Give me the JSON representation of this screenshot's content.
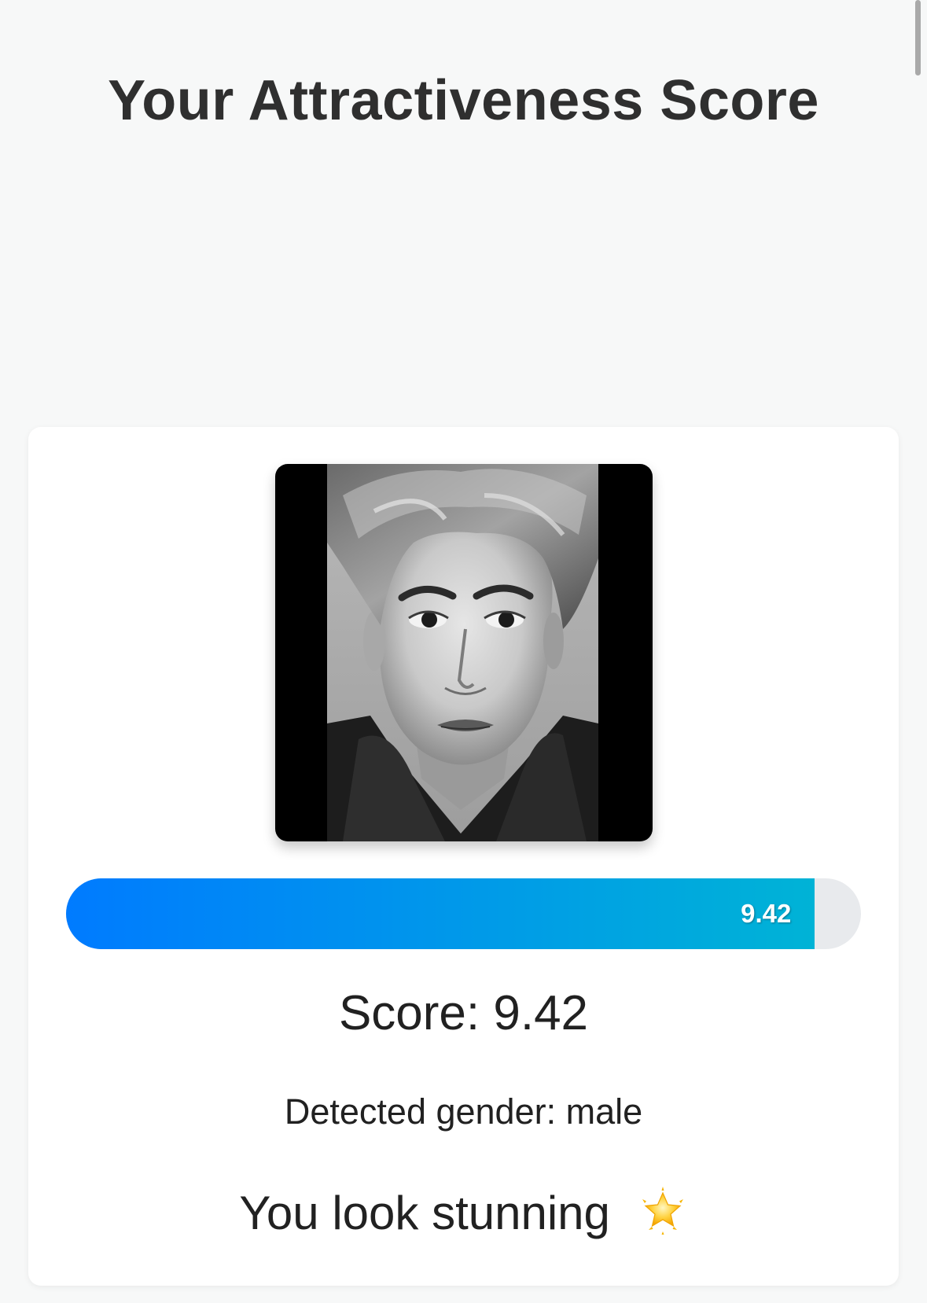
{
  "page": {
    "title": "Your Attractiveness Score"
  },
  "result": {
    "photo_alt": "Uploaded face photo",
    "score_fraction": 0.942,
    "score_max": 10,
    "bar_label": "9.42",
    "score_text": "Score: 9.42",
    "gender_text": "Detected gender: male",
    "message": "You look stunning",
    "message_icon": "glowing-star-icon"
  },
  "colors": {
    "background": "#f7f8f8",
    "card": "#ffffff",
    "bar_start": "#007bff",
    "bar_end": "#00b3d6",
    "bar_track": "#e8eaed",
    "text": "#212121"
  }
}
